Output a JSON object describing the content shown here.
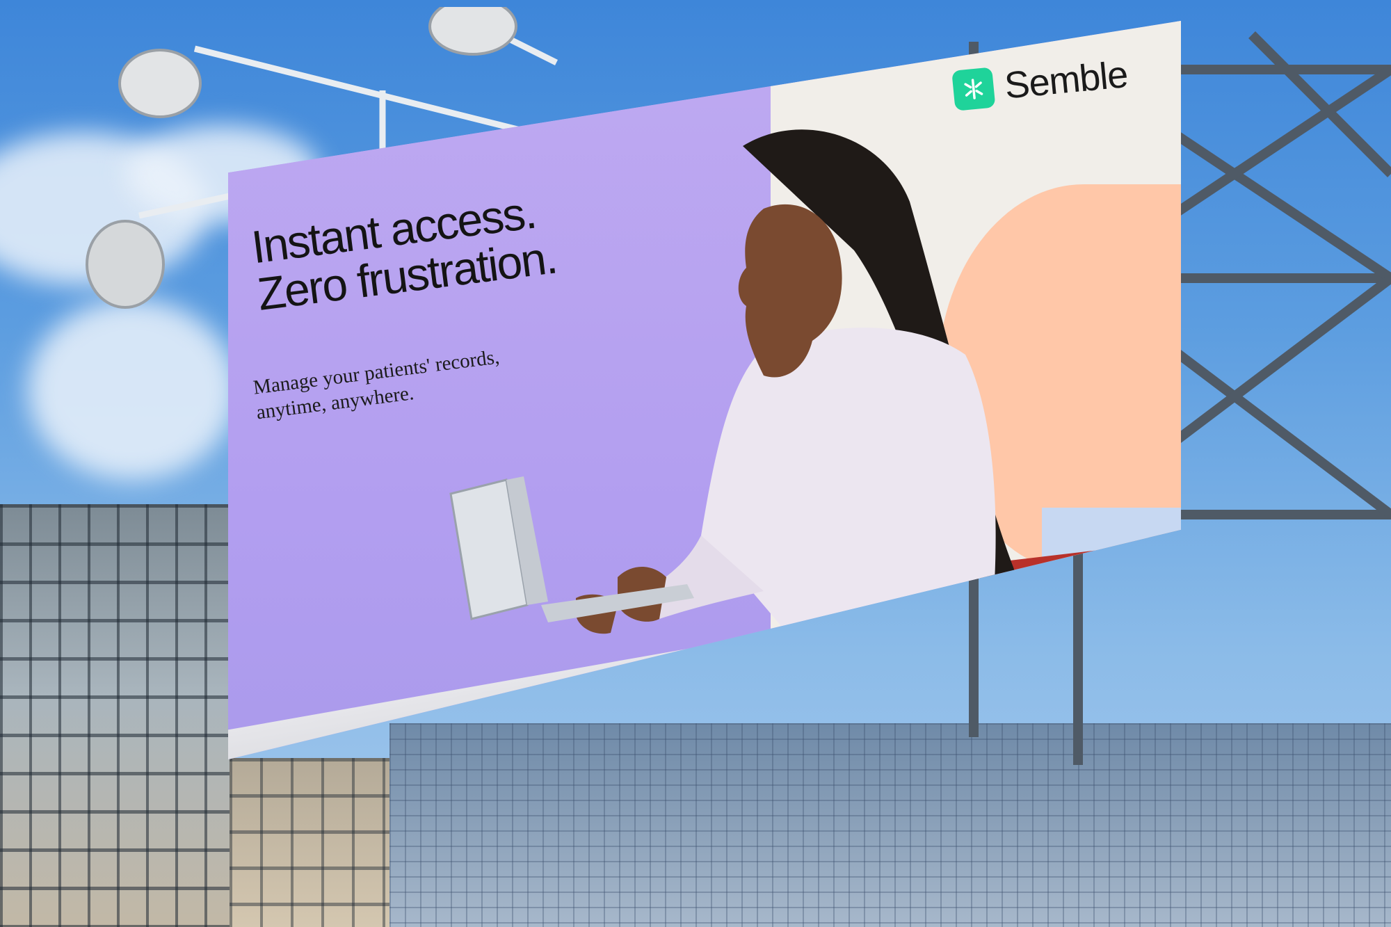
{
  "billboard": {
    "brand": "Semble",
    "headline": [
      "Instant access.",
      "Zero frustration."
    ],
    "subline": [
      "Manage your patients' records,",
      "anytime, anywhere."
    ]
  },
  "colors": {
    "board_purple": "#b8a6ee",
    "board_light": "#f1eee9",
    "peach": "#ffc7a8",
    "brand_green": "#1fd39a",
    "sky": "#5c9de0"
  },
  "icons": [
    "semble-logo-icon",
    "floodlight-icon"
  ]
}
